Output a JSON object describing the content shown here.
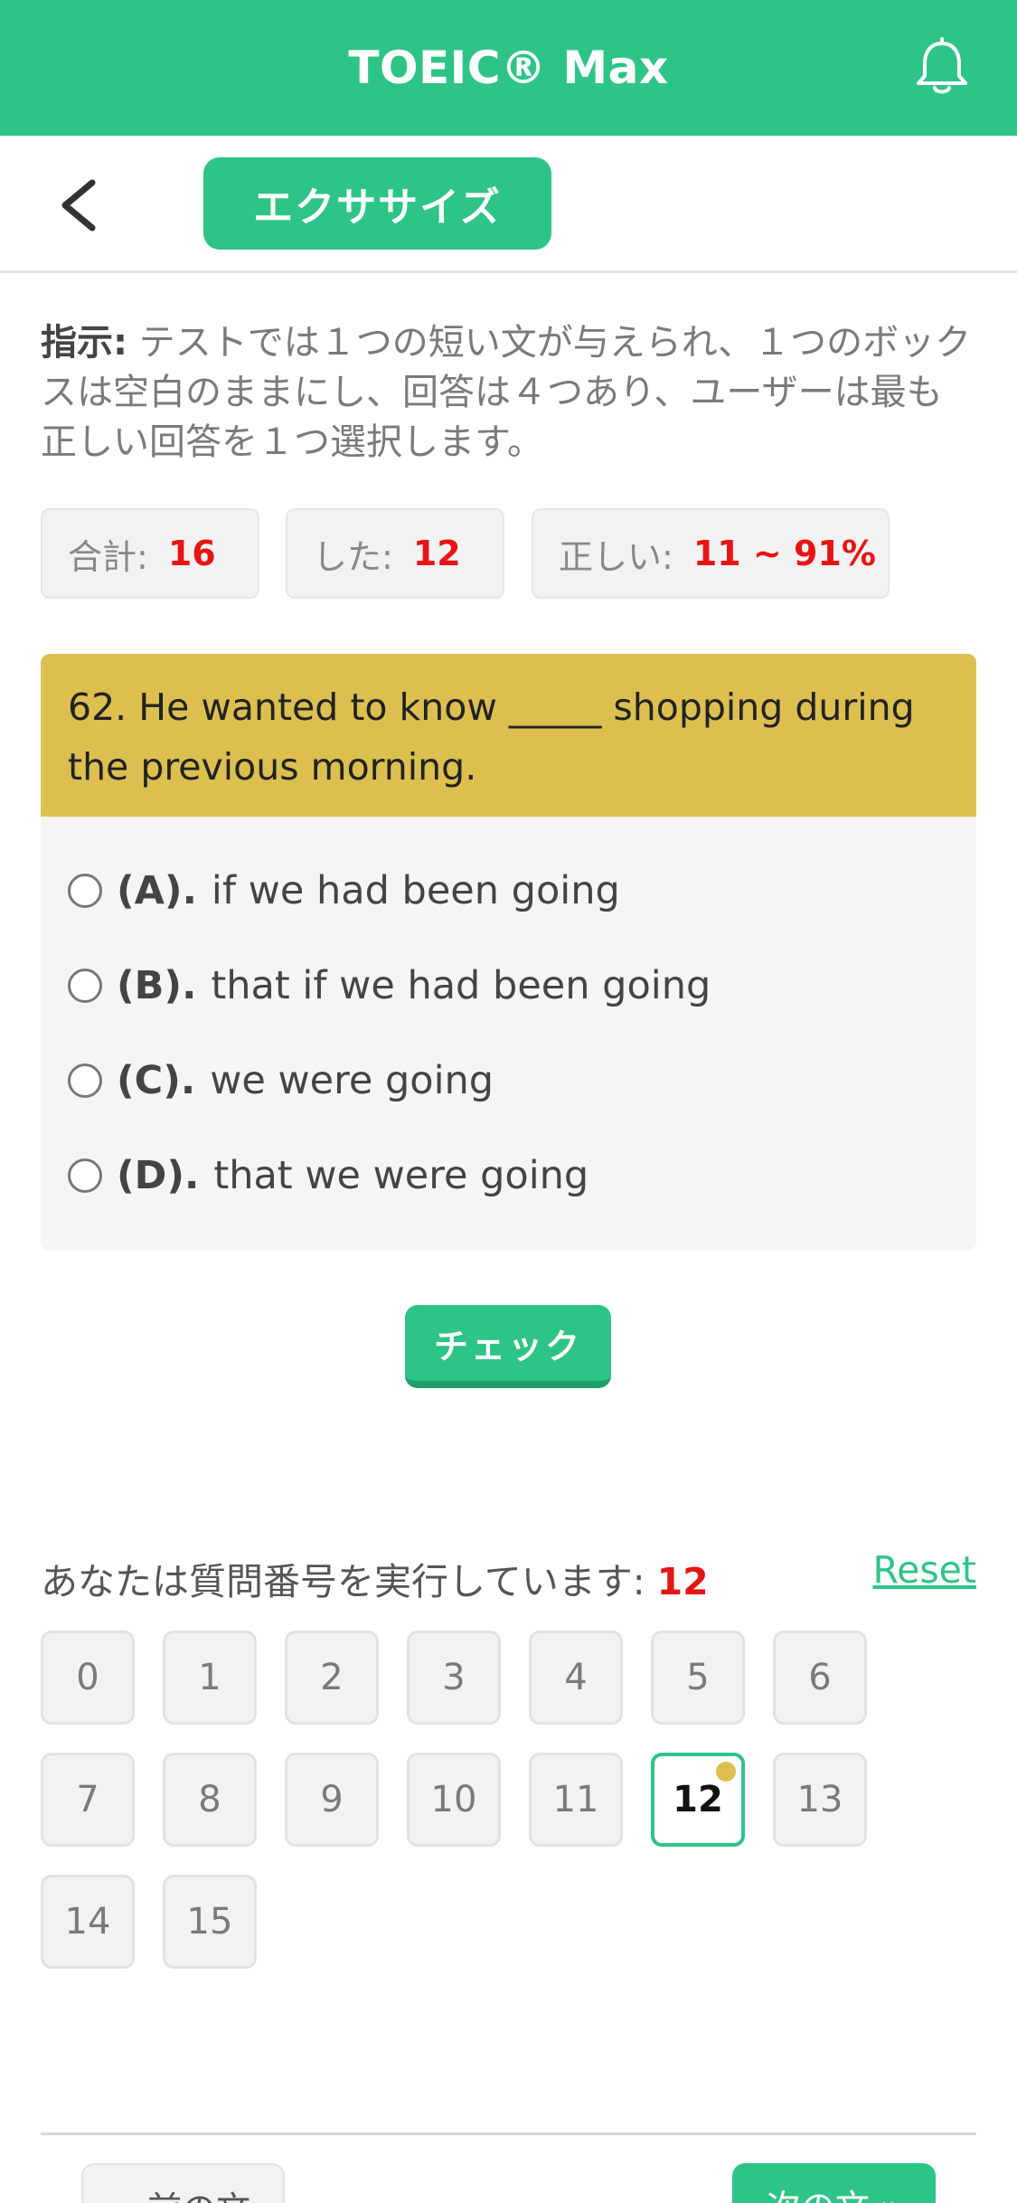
{
  "header": {
    "title": "TOEIC® Max",
    "bell_icon": "bell-icon"
  },
  "subnav": {
    "back_icon": "chevron-left-icon",
    "tab_label": "エクササイズ"
  },
  "instructions": {
    "label": "指示:",
    "text": " テストでは１つの短い文が与えられ、１つのボックスは空白のままにし、回答は４つあり、ユーザーは最も正しい回答を１つ選択します。"
  },
  "stats": {
    "total_label": "合計:",
    "total_value": "16",
    "done_label": "した:",
    "done_value": "12",
    "correct_label": "正しい:",
    "correct_value": "11 ~ 91%"
  },
  "question": {
    "text": "62. He wanted to know _____ shopping during the previous morning.",
    "options": [
      {
        "letter": "(A).",
        "text": "if we had been going"
      },
      {
        "letter": "(B).",
        "text": "that if we had been going"
      },
      {
        "letter": "(C).",
        "text": "we were going"
      },
      {
        "letter": "(D).",
        "text": "that we were going"
      }
    ]
  },
  "check_label": "チェック",
  "progress": {
    "running_label": "あなたは質問番号を実行しています:",
    "current": "12",
    "reset_label": "Reset",
    "numbers": [
      "0",
      "1",
      "2",
      "3",
      "4",
      "5",
      "6",
      "7",
      "8",
      "9",
      "10",
      "11",
      "12",
      "13",
      "14",
      "15"
    ]
  },
  "bottom_nav": {
    "prev_label": "« 前の文",
    "next_label": "次の文 »"
  },
  "colors": {
    "accent": "#2ec487",
    "question_bg": "#dcbf4f",
    "highlight": "#e61515"
  }
}
